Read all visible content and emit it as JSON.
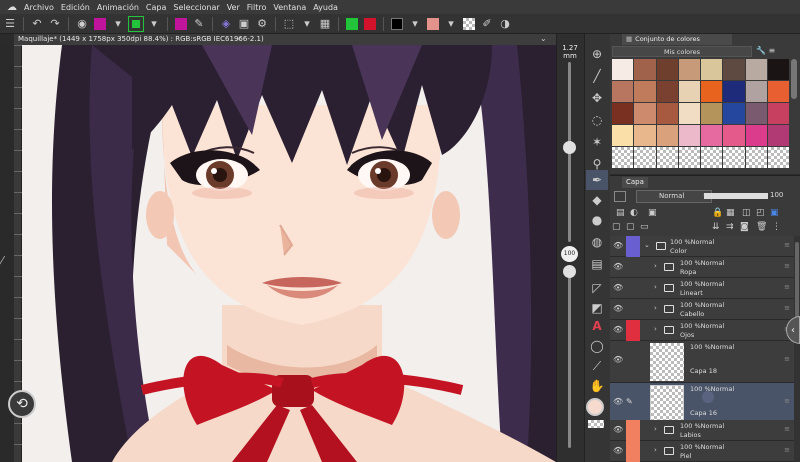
{
  "menu": {
    "items": [
      "Archivo",
      "Edición",
      "Animación",
      "Capa",
      "Seleccionar",
      "Ver",
      "Filtro",
      "Ventana",
      "Ayuda"
    ]
  },
  "document": {
    "tab_title": "Maquillaje* (1449 x 1758px 350dpi 88.4%) : RGB:sRGB IEC61966-2.1)",
    "close_glyph": "×"
  },
  "zoom": {
    "brush_size": "1.27",
    "brush_unit": "mm"
  },
  "opacity_badge": "100",
  "colors": {
    "toolbar_magenta": "#c0159b",
    "toolbar_green": "#22c43a",
    "toolbar_red": "#d3132b",
    "toolbar_pink": "#e4928c",
    "selected_layer": "#4a5468",
    "fg_color": "#f5dacd"
  },
  "color_set": {
    "tab_label": "Conjunto de colores",
    "set_name": "Mis colores",
    "swatches": [
      "#f7ebe6",
      "#a0624a",
      "#6e3f2c",
      "#c79a7a",
      "#d9c69a",
      "#5e4a40",
      "#b8aaa0",
      "#1a1414",
      "#b87660",
      "#c07a5c",
      "#7a4030",
      "#e8d2b4",
      "#e8641e",
      "#1e2b7a",
      "#b0a2a0",
      "#e86032",
      "#7a3020",
      "#ce8a6c",
      "#a85a40",
      "#f0ddc4",
      "#b4945a",
      "#26479e",
      "#7a5a6e",
      "#c84060",
      "#fae0a8",
      "#e8b88c",
      "#d9a27c",
      "#ecb9ca",
      "#e66aa0",
      "#e45a8a",
      "#dc3c8c",
      "#b23a74",
      "chk",
      "chk",
      "chk",
      "chk",
      "chk",
      "chk",
      "chk",
      "chk"
    ]
  },
  "layers": {
    "tab_label": "Capa",
    "blend_mode": "Normal",
    "opacity": "100",
    "rows": [
      {
        "pct": "100 %Normal",
        "name": "Color",
        "lock_color": "#6a5fd0",
        "open": true
      },
      {
        "pct": "100 %Normal",
        "name": "Ropa",
        "lock_color": "#3d3d3d"
      },
      {
        "pct": "100 %Normal",
        "name": "Lineart",
        "lock_color": "#3d3d3d"
      },
      {
        "pct": "100 %Normal",
        "name": "Cabello",
        "lock_color": "#3d3d3d"
      },
      {
        "pct": "100 %Normal",
        "name": "Ojos",
        "lock_color": "#e03040"
      },
      {
        "pct": "100 %Normal",
        "name": "Capa 18",
        "lock_color": "#3d3d3d",
        "raster": true
      },
      {
        "pct": "100 %Normal",
        "name": "Capa 16",
        "lock_color": "#3d3d3d",
        "raster": true,
        "selected": true
      },
      {
        "pct": "100 %Normal",
        "name": "Labios",
        "lock_color": "#f08060"
      },
      {
        "pct": "100 %Normal",
        "name": "Piel",
        "lock_color": "#f08060"
      }
    ]
  }
}
